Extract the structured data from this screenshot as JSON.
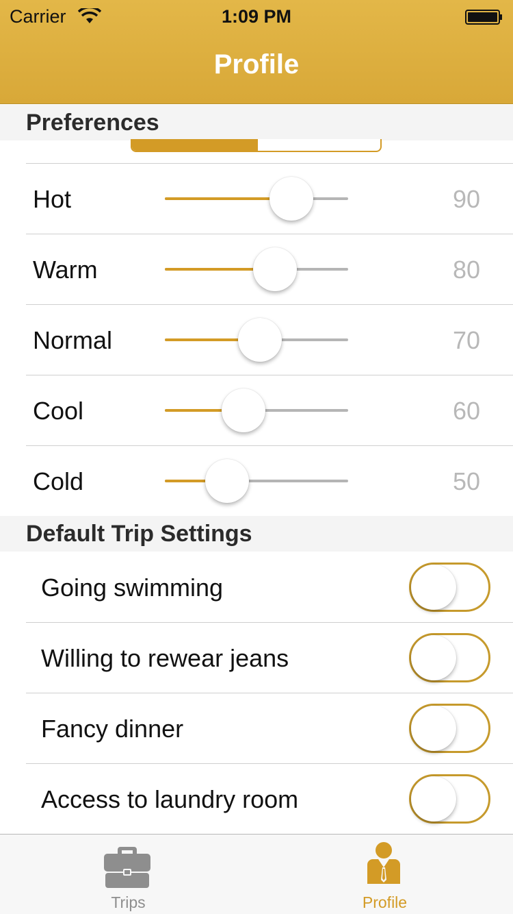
{
  "status_bar": {
    "carrier": "Carrier",
    "time": "1:09 PM"
  },
  "nav": {
    "title": "Profile"
  },
  "preferences": {
    "header": "Preferences",
    "rows": [
      {
        "label": "Hot",
        "value": "90",
        "level": 0.69
      },
      {
        "label": "Warm",
        "value": "80",
        "level": 0.6
      },
      {
        "label": "Normal",
        "value": "70",
        "level": 0.52
      },
      {
        "label": "Cool",
        "value": "60",
        "level": 0.43
      },
      {
        "label": "Cold",
        "value": "50",
        "level": 0.34
      }
    ]
  },
  "trip_settings": {
    "header": "Default Trip Settings",
    "rows": [
      {
        "label": "Going swimming",
        "on": false
      },
      {
        "label": "Willing to rewear jeans",
        "on": false
      },
      {
        "label": "Fancy dinner",
        "on": false
      },
      {
        "label": "Access to laundry room",
        "on": false
      }
    ]
  },
  "tabs": [
    {
      "label": "Trips",
      "icon": "briefcase-icon",
      "selected": false
    },
    {
      "label": "Profile",
      "icon": "person-tie-icon",
      "selected": true
    }
  ],
  "colors": {
    "accent": "#d39b26",
    "header": "#dfb142",
    "inactive": "#8e8e8e"
  }
}
